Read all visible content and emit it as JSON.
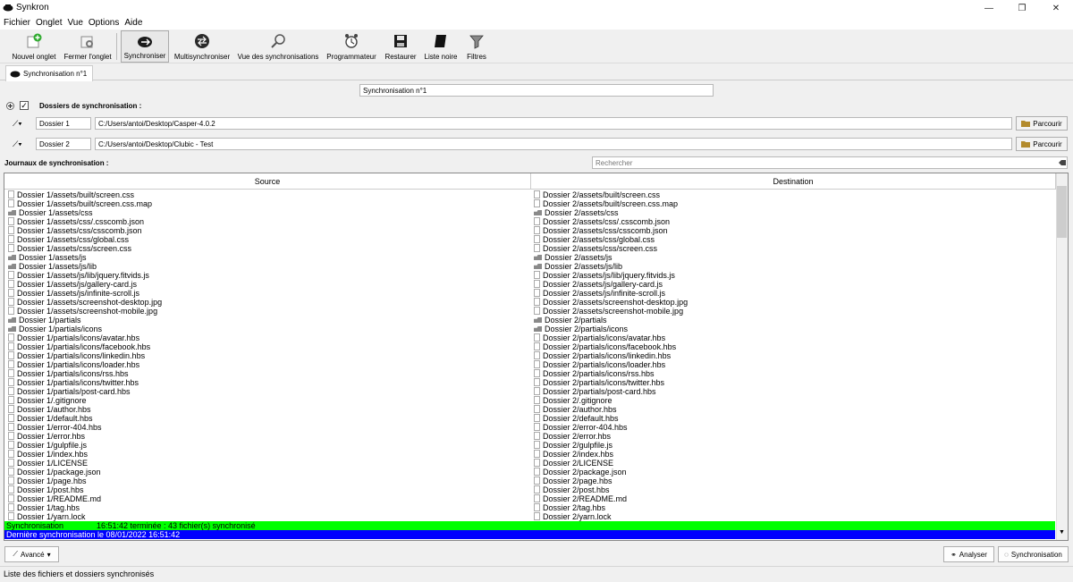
{
  "window": {
    "title": "Synkron",
    "minimize": "—",
    "restore": "❐",
    "close": "✕"
  },
  "menu": [
    "Fichier",
    "Onglet",
    "Vue",
    "Options",
    "Aide"
  ],
  "toolbar": {
    "new_tab": "Nouvel onglet",
    "close_tab": "Fermer l'onglet",
    "sync": "Synchroniser",
    "multisync": "Multisynchroniser",
    "sync_view": "Vue des synchronisations",
    "scheduler": "Programmateur",
    "restore": "Restaurer",
    "blacklist": "Liste noire",
    "filters": "Filtres"
  },
  "tabs": [
    {
      "label": "Synchronisation n°1"
    }
  ],
  "sync_name": "Synchronisation n°1",
  "folders": {
    "section_label": "Dossiers de synchronisation :",
    "items": [
      {
        "name": "Dossier 1",
        "path": "C:/Users/antoi/Desktop/Casper-4.0.2",
        "browse": "Parcourir"
      },
      {
        "name": "Dossier 2",
        "path": "C:/Users/antoi/Desktop/Clubic - Test",
        "browse": "Parcourir"
      }
    ]
  },
  "logs_label": "Journaux de synchronisation :",
  "search_placeholder": "Rechercher",
  "table": {
    "headers": {
      "source": "Source",
      "destination": "Destination"
    },
    "rows": [
      {
        "type": "file",
        "src": "Dossier 1/assets/built/screen.css",
        "dst": "Dossier 2/assets/built/screen.css"
      },
      {
        "type": "file",
        "src": "Dossier 1/assets/built/screen.css.map",
        "dst": "Dossier 2/assets/built/screen.css.map"
      },
      {
        "type": "folder",
        "src": "Dossier 1/assets/css",
        "dst": "Dossier 2/assets/css"
      },
      {
        "type": "file",
        "src": "Dossier 1/assets/css/.csscomb.json",
        "dst": "Dossier 2/assets/css/.csscomb.json"
      },
      {
        "type": "file",
        "src": "Dossier 1/assets/css/csscomb.json",
        "dst": "Dossier 2/assets/css/csscomb.json"
      },
      {
        "type": "file",
        "src": "Dossier 1/assets/css/global.css",
        "dst": "Dossier 2/assets/css/global.css"
      },
      {
        "type": "file",
        "src": "Dossier 1/assets/css/screen.css",
        "dst": "Dossier 2/assets/css/screen.css"
      },
      {
        "type": "folder",
        "src": "Dossier 1/assets/js",
        "dst": "Dossier 2/assets/js"
      },
      {
        "type": "folder",
        "src": "Dossier 1/assets/js/lib",
        "dst": "Dossier 2/assets/js/lib"
      },
      {
        "type": "file",
        "src": "Dossier 1/assets/js/lib/jquery.fitvids.js",
        "dst": "Dossier 2/assets/js/lib/jquery.fitvids.js"
      },
      {
        "type": "file",
        "src": "Dossier 1/assets/js/gallery-card.js",
        "dst": "Dossier 2/assets/js/gallery-card.js"
      },
      {
        "type": "file",
        "src": "Dossier 1/assets/js/infinite-scroll.js",
        "dst": "Dossier 2/assets/js/infinite-scroll.js"
      },
      {
        "type": "file",
        "src": "Dossier 1/assets/screenshot-desktop.jpg",
        "dst": "Dossier 2/assets/screenshot-desktop.jpg"
      },
      {
        "type": "file",
        "src": "Dossier 1/assets/screenshot-mobile.jpg",
        "dst": "Dossier 2/assets/screenshot-mobile.jpg"
      },
      {
        "type": "folder",
        "src": "Dossier 1/partials",
        "dst": "Dossier 2/partials"
      },
      {
        "type": "folder",
        "src": "Dossier 1/partials/icons",
        "dst": "Dossier 2/partials/icons"
      },
      {
        "type": "file",
        "src": "Dossier 1/partials/icons/avatar.hbs",
        "dst": "Dossier 2/partials/icons/avatar.hbs"
      },
      {
        "type": "file",
        "src": "Dossier 1/partials/icons/facebook.hbs",
        "dst": "Dossier 2/partials/icons/facebook.hbs"
      },
      {
        "type": "file",
        "src": "Dossier 1/partials/icons/linkedin.hbs",
        "dst": "Dossier 2/partials/icons/linkedin.hbs"
      },
      {
        "type": "file",
        "src": "Dossier 1/partials/icons/loader.hbs",
        "dst": "Dossier 2/partials/icons/loader.hbs"
      },
      {
        "type": "file",
        "src": "Dossier 1/partials/icons/rss.hbs",
        "dst": "Dossier 2/partials/icons/rss.hbs"
      },
      {
        "type": "file",
        "src": "Dossier 1/partials/icons/twitter.hbs",
        "dst": "Dossier 2/partials/icons/twitter.hbs"
      },
      {
        "type": "file",
        "src": "Dossier 1/partials/post-card.hbs",
        "dst": "Dossier 2/partials/post-card.hbs"
      },
      {
        "type": "file",
        "src": "Dossier 1/.gitignore",
        "dst": "Dossier 2/.gitignore"
      },
      {
        "type": "file",
        "src": "Dossier 1/author.hbs",
        "dst": "Dossier 2/author.hbs"
      },
      {
        "type": "file",
        "src": "Dossier 1/default.hbs",
        "dst": "Dossier 2/default.hbs"
      },
      {
        "type": "file",
        "src": "Dossier 1/error-404.hbs",
        "dst": "Dossier 2/error-404.hbs"
      },
      {
        "type": "file",
        "src": "Dossier 1/error.hbs",
        "dst": "Dossier 2/error.hbs"
      },
      {
        "type": "file",
        "src": "Dossier 1/gulpfile.js",
        "dst": "Dossier 2/gulpfile.js"
      },
      {
        "type": "file",
        "src": "Dossier 1/index.hbs",
        "dst": "Dossier 2/index.hbs"
      },
      {
        "type": "file",
        "src": "Dossier 1/LICENSE",
        "dst": "Dossier 2/LICENSE"
      },
      {
        "type": "file",
        "src": "Dossier 1/package.json",
        "dst": "Dossier 2/package.json"
      },
      {
        "type": "file",
        "src": "Dossier 1/page.hbs",
        "dst": "Dossier 2/page.hbs"
      },
      {
        "type": "file",
        "src": "Dossier 1/post.hbs",
        "dst": "Dossier 2/post.hbs"
      },
      {
        "type": "file",
        "src": "Dossier 1/README.md",
        "dst": "Dossier 2/README.md"
      },
      {
        "type": "file",
        "src": "Dossier 1/tag.hbs",
        "dst": "Dossier 2/tag.hbs"
      },
      {
        "type": "file",
        "src": "Dossier 1/yarn.lock",
        "dst": "Dossier 2/yarn.lock"
      }
    ]
  },
  "status_rows": {
    "green_left": "Synchronisation",
    "green_right": "16:51:42 terminée : 43 fichier(s) synchronisé",
    "blue": "Dernière synchronisation le 08/01/2022 16:51:42"
  },
  "buttons": {
    "advanced": "Avancé",
    "analyze": "Analyser",
    "synchronise": "Synchronisation"
  },
  "statusbar": "Liste des fichiers et dossiers synchronisés"
}
